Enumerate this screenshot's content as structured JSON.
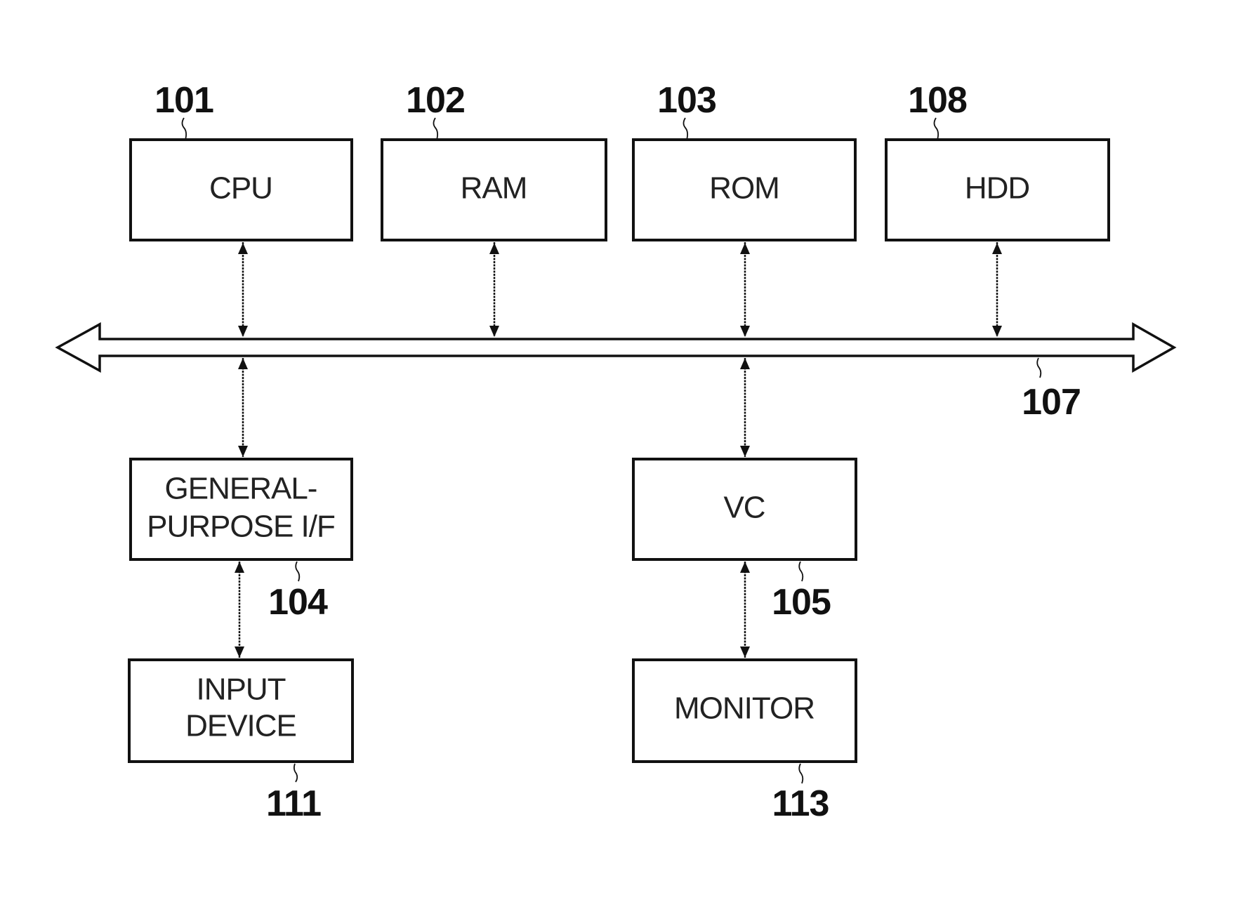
{
  "diagram": {
    "type": "block-diagram",
    "bus": {
      "ref": "107"
    },
    "blocks": [
      {
        "id": "cpu",
        "ref": "101",
        "lines": [
          "CPU"
        ]
      },
      {
        "id": "ram",
        "ref": "102",
        "lines": [
          "RAM"
        ]
      },
      {
        "id": "rom",
        "ref": "103",
        "lines": [
          "ROM"
        ]
      },
      {
        "id": "hdd",
        "ref": "108",
        "lines": [
          "HDD"
        ]
      },
      {
        "id": "gpif",
        "ref": "104",
        "lines": [
          "GENERAL-",
          "PURPOSE I/F"
        ]
      },
      {
        "id": "vc",
        "ref": "105",
        "lines": [
          "VC"
        ]
      },
      {
        "id": "input",
        "ref": "111",
        "lines": [
          "INPUT",
          "DEVICE"
        ]
      },
      {
        "id": "monitor",
        "ref": "113",
        "lines": [
          "MONITOR"
        ]
      }
    ],
    "connections": [
      {
        "from": "cpu",
        "to": "bus",
        "bidirectional": true
      },
      {
        "from": "ram",
        "to": "bus",
        "bidirectional": true
      },
      {
        "from": "rom",
        "to": "bus",
        "bidirectional": true
      },
      {
        "from": "hdd",
        "to": "bus",
        "bidirectional": true
      },
      {
        "from": "bus",
        "to": "gpif",
        "bidirectional": true
      },
      {
        "from": "bus",
        "to": "vc",
        "bidirectional": true
      },
      {
        "from": "gpif",
        "to": "input",
        "bidirectional": true
      },
      {
        "from": "vc",
        "to": "monitor",
        "bidirectional": true
      }
    ]
  }
}
